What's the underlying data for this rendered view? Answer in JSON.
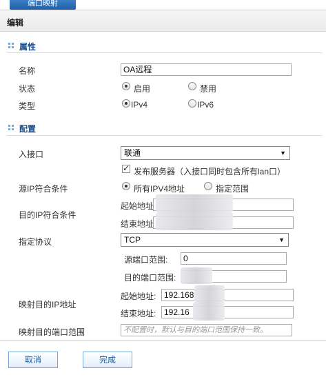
{
  "tab": {
    "label": "端口映射"
  },
  "edit_bar": {
    "title": "编辑"
  },
  "sections": {
    "attributes": "属性",
    "config": "配置"
  },
  "attributes": {
    "name_label": "名称",
    "name_value": "OA远程",
    "status_label": "状态",
    "status_enable": "启用",
    "status_disable": "禁用",
    "status_selected": "启用",
    "type_label": "类型",
    "type_ipv4": "IPv4",
    "type_ipv6": "IPv6",
    "type_selected": "IPv4"
  },
  "config": {
    "ingress_label": "入接口",
    "ingress_value": "联通",
    "publish_server_label": "发布服务器（入接口同时包含所有lan口）",
    "publish_server_checked": true,
    "src_ip_label": "源IP符合条件",
    "src_ip_all": "所有IPV4地址",
    "src_ip_range": "指定范围",
    "src_ip_selected": "所有IPV4地址",
    "dst_ip_label": "目的IP符合条件",
    "start_addr_label": "起始地址",
    "end_addr_label": "结束地址",
    "protocol_label": "指定协议",
    "protocol_value": "TCP",
    "src_port_range_label": "源端口范围:",
    "src_port_range_value": "0",
    "dst_port_range_label": "目的端口范围:",
    "map_ip_label": "映射目的IP地址",
    "map_start_label": "起始地址:",
    "map_start_value": "192.168",
    "map_end_label": "结束地址:",
    "map_end_value": "192.16",
    "map_port_label": "映射目的端口范围",
    "map_port_placeholder": "不配置时，默认与目的端口范围保持一致。"
  },
  "buttons": {
    "cancel": "取消",
    "done": "完成"
  },
  "colors": {
    "accent": "#1e5fa8",
    "section_title": "#1a4f8c",
    "button_text": "#1a5ea8"
  }
}
